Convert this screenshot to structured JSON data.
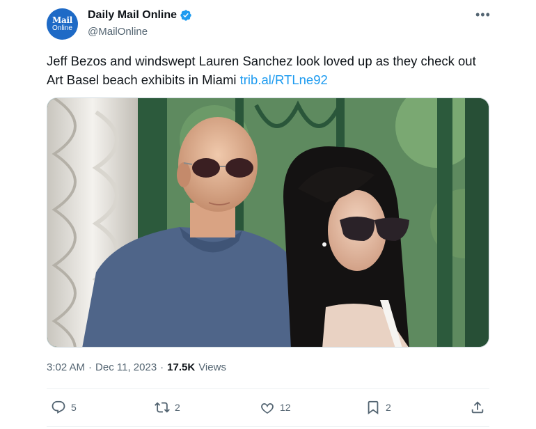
{
  "author": {
    "avatar_line1": "Mail",
    "avatar_line2": "Online",
    "display_name": "Daily Mail Online",
    "handle": "@MailOnline",
    "verified_icon": "verified-badge-icon"
  },
  "tweet": {
    "text": "Jeff Bezos and windswept Lauren Sanchez look loved up as they check out Art Basel beach exhibits in Miami ",
    "link": "trib.al/RTLne92"
  },
  "meta": {
    "time": "3:02 AM",
    "separator": "·",
    "date": "Dec 11, 2023",
    "views_count": "17.5K",
    "views_label": "Views"
  },
  "actions": {
    "replies": "5",
    "retweets": "2",
    "likes": "12",
    "bookmarks": "2"
  },
  "colors": {
    "accent": "#1d9bf0",
    "secondary_text": "#536471",
    "primary_text": "#0f1419"
  }
}
